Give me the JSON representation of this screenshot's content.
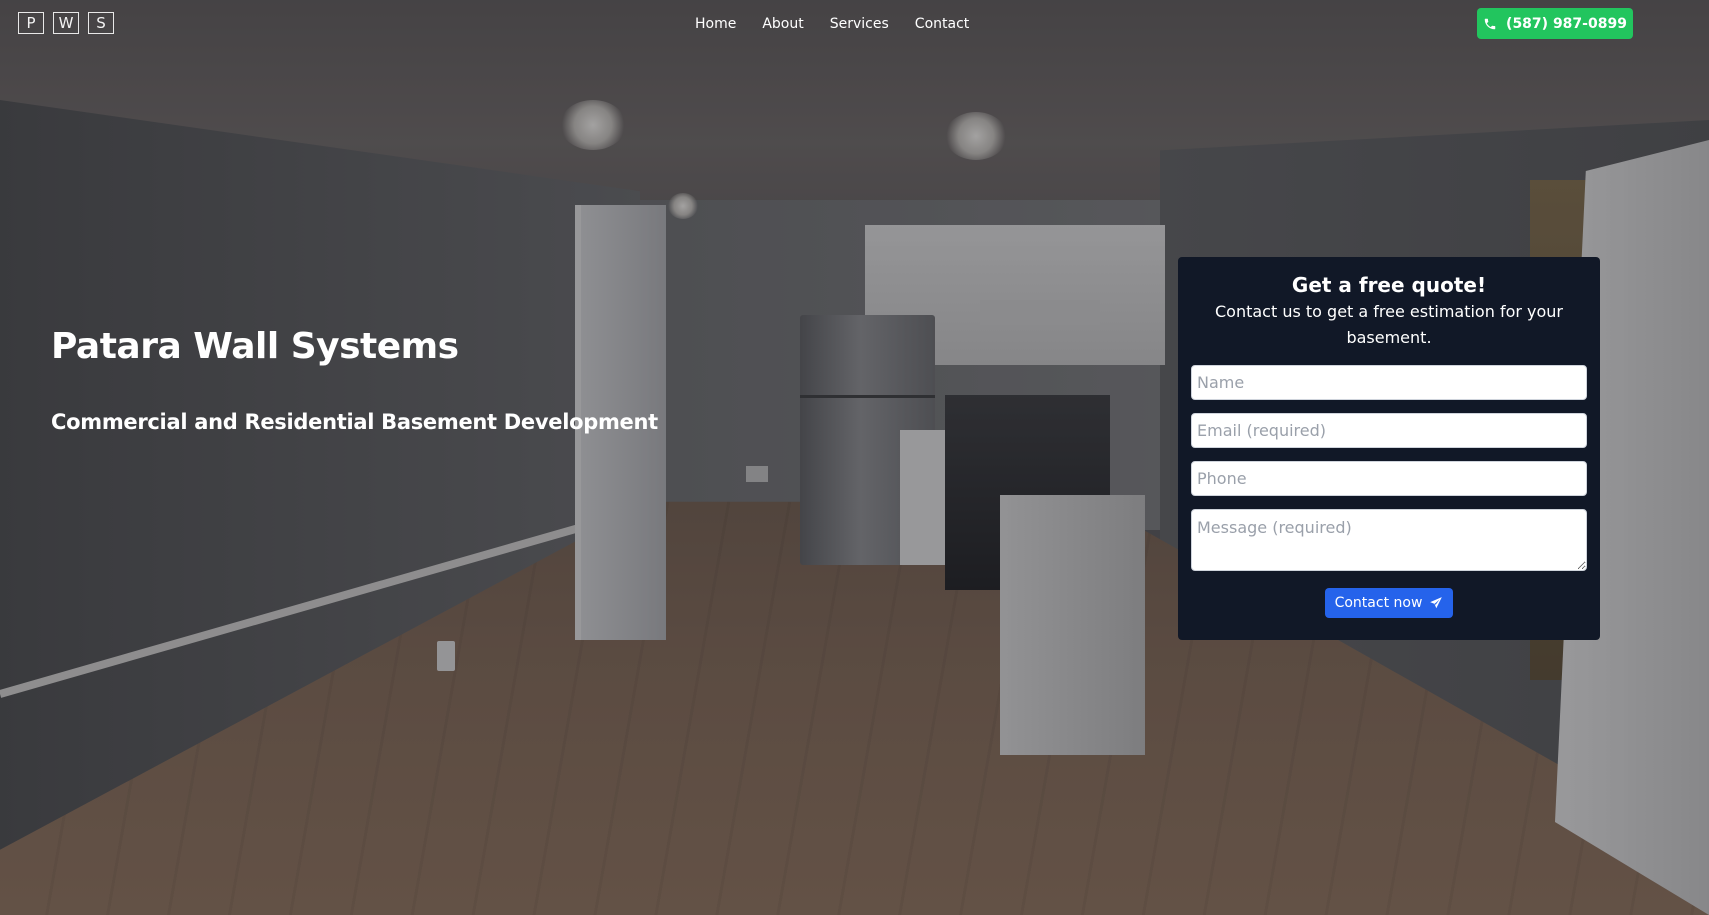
{
  "header": {
    "logo_letters": [
      "P",
      "W",
      "S"
    ],
    "nav": [
      {
        "label": "Home"
      },
      {
        "label": "About"
      },
      {
        "label": "Services"
      },
      {
        "label": "Contact"
      }
    ],
    "phone": {
      "label": "(587) 987-0899",
      "icon": "phone-icon",
      "color": "#22c55e"
    }
  },
  "hero": {
    "title": "Patara Wall Systems",
    "subtitle": "Commercial and Residential Basement Development"
  },
  "quote": {
    "title": "Get a free quote!",
    "description": "Contact us to get a free estimation for your basement.",
    "fields": {
      "name_placeholder": "Name",
      "email_placeholder": "Email (required)",
      "phone_placeholder": "Phone",
      "message_placeholder": "Message (required)"
    },
    "submit": {
      "label": "Contact now",
      "icon": "paper-plane-icon",
      "color": "#2563eb"
    },
    "card_color": "#111827"
  }
}
